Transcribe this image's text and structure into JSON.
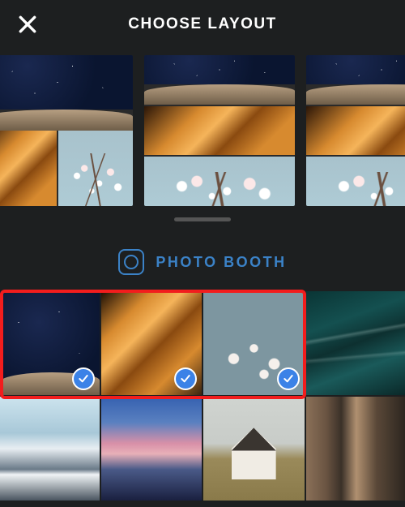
{
  "header": {
    "title": "CHOOSE LAYOUT"
  },
  "photo_booth": {
    "label": "PHOTO BOOTH"
  },
  "icons": {
    "close": "close-icon",
    "camera": "camera-icon",
    "check": "check-icon"
  },
  "colors": {
    "accent_blue": "#3b82c7",
    "check_blue": "#3b82e7",
    "highlight_red": "#f21d1d",
    "background": "#1d1f20"
  },
  "layouts": [
    {
      "id": "layout-2x2-split",
      "panes": [
        "night-rock",
        "canyon",
        "blossom"
      ]
    },
    {
      "id": "layout-3-rows",
      "panes": [
        "night-rock",
        "canyon",
        "blossom"
      ]
    },
    {
      "id": "layout-3-rows-alt",
      "panes": [
        "night-rock",
        "canyon",
        "blossom"
      ]
    }
  ],
  "thumbnails": [
    {
      "id": "night-rock",
      "selected": true
    },
    {
      "id": "canyon",
      "selected": true
    },
    {
      "id": "blossom",
      "selected": true
    },
    {
      "id": "ocean-waves",
      "selected": false
    },
    {
      "id": "snow-mountain",
      "selected": false
    },
    {
      "id": "pink-mountain",
      "selected": false
    },
    {
      "id": "wood-house",
      "selected": false
    },
    {
      "id": "cliff-face",
      "selected": false
    }
  ],
  "highlight": {
    "covers_thumbnails": [
      "night-rock",
      "canyon",
      "blossom"
    ]
  }
}
